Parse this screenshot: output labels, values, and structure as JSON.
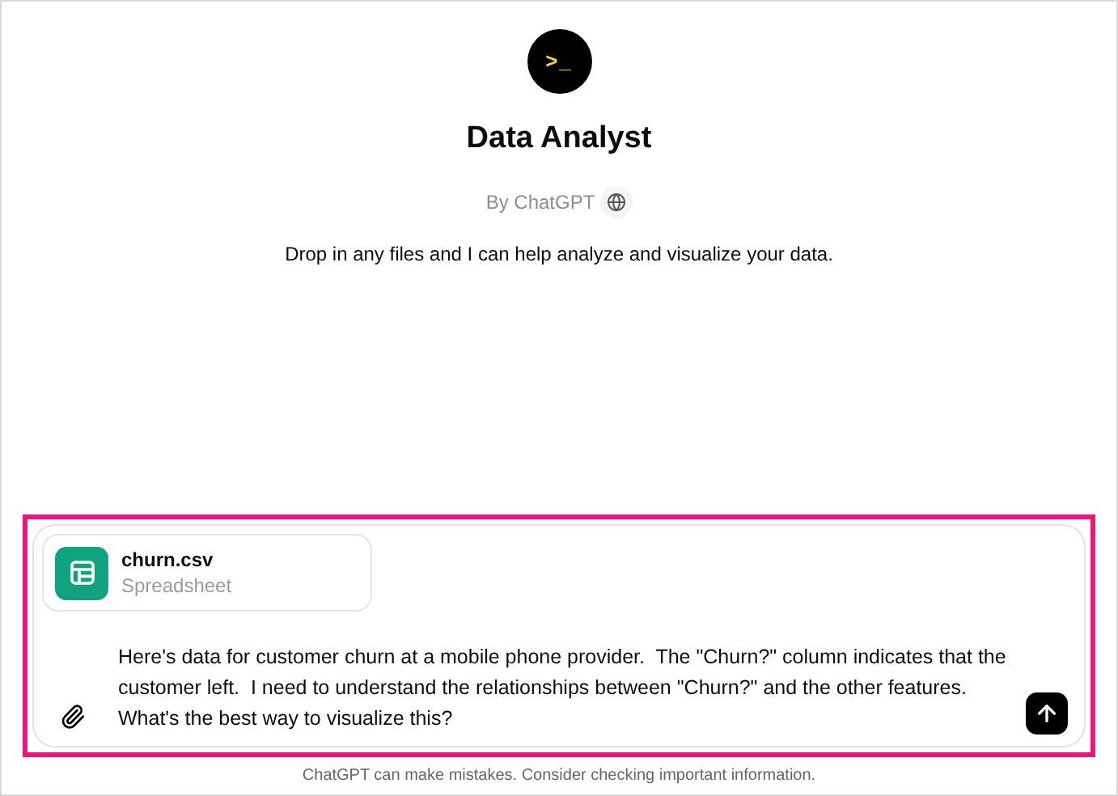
{
  "header": {
    "logo_text": ">_",
    "title": "Data Analyst",
    "byline": "By ChatGPT",
    "description": "Drop in any files and I can help analyze and visualize your data."
  },
  "composer": {
    "highlighted": true,
    "attachment": {
      "name": "churn.csv",
      "type": "Spreadsheet"
    },
    "message": "Here's data for customer churn at a mobile phone provider.  The \"Churn?\" column indicates that the customer left.  I need to understand the relationships between \"Churn?\" and the other features.  What's the best way to visualize this?"
  },
  "footer": "ChatGPT can make mistakes. Consider checking important information."
}
